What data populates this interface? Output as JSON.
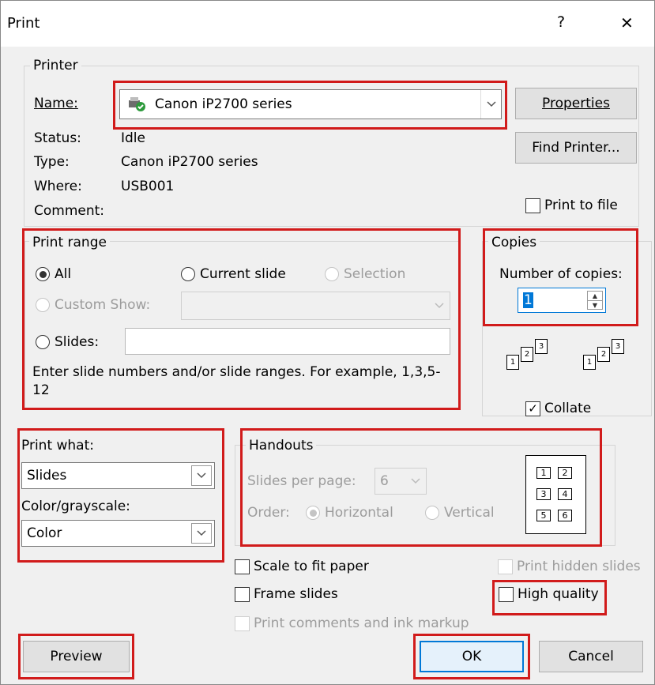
{
  "window": {
    "title": "Print",
    "help": "?",
    "close": "✕"
  },
  "printer": {
    "legend": "Printer",
    "name_label": "Name:",
    "name_value": "Canon iP2700 series",
    "status_label": "Status:",
    "status_value": "Idle",
    "type_label": "Type:",
    "type_value": "Canon iP2700 series",
    "where_label": "Where:",
    "where_value": "USB001",
    "comment_label": "Comment:",
    "properties": "Properties",
    "find_printer": "Find Printer...",
    "print_to_file": "Print to file"
  },
  "range": {
    "legend": "Print range",
    "all": "All",
    "current_slide": "Current slide",
    "selection": "Selection",
    "custom_show": "Custom Show:",
    "slides": "Slides:",
    "hint": "Enter slide numbers and/or slide ranges. For example, 1,3,5-12"
  },
  "copies": {
    "legend": "Copies",
    "number_label": "Number of copies:",
    "number_value": "1",
    "collate": "Collate",
    "stack_pages": [
      "1",
      "2",
      "3"
    ]
  },
  "print_what": {
    "label": "Print what:",
    "value": "Slides"
  },
  "color": {
    "label": "Color/grayscale:",
    "value": "Color"
  },
  "handouts": {
    "legend": "Handouts",
    "slides_per_page_label": "Slides per page:",
    "slides_per_page_value": "6",
    "order_label": "Order:",
    "horizontal": "Horizontal",
    "vertical": "Vertical",
    "preview_cells": [
      "1",
      "2",
      "3",
      "4",
      "5",
      "6"
    ]
  },
  "options": {
    "scale_to_fit": "Scale to fit paper",
    "frame_slides": "Frame slides",
    "print_comments": "Print comments and ink markup",
    "print_hidden": "Print hidden slides",
    "high_quality": "High quality"
  },
  "buttons": {
    "preview": "Preview",
    "ok": "OK",
    "cancel": "Cancel"
  },
  "colors": {
    "highlight_red": "#d11b1b",
    "ok_border": "#0078d7"
  }
}
